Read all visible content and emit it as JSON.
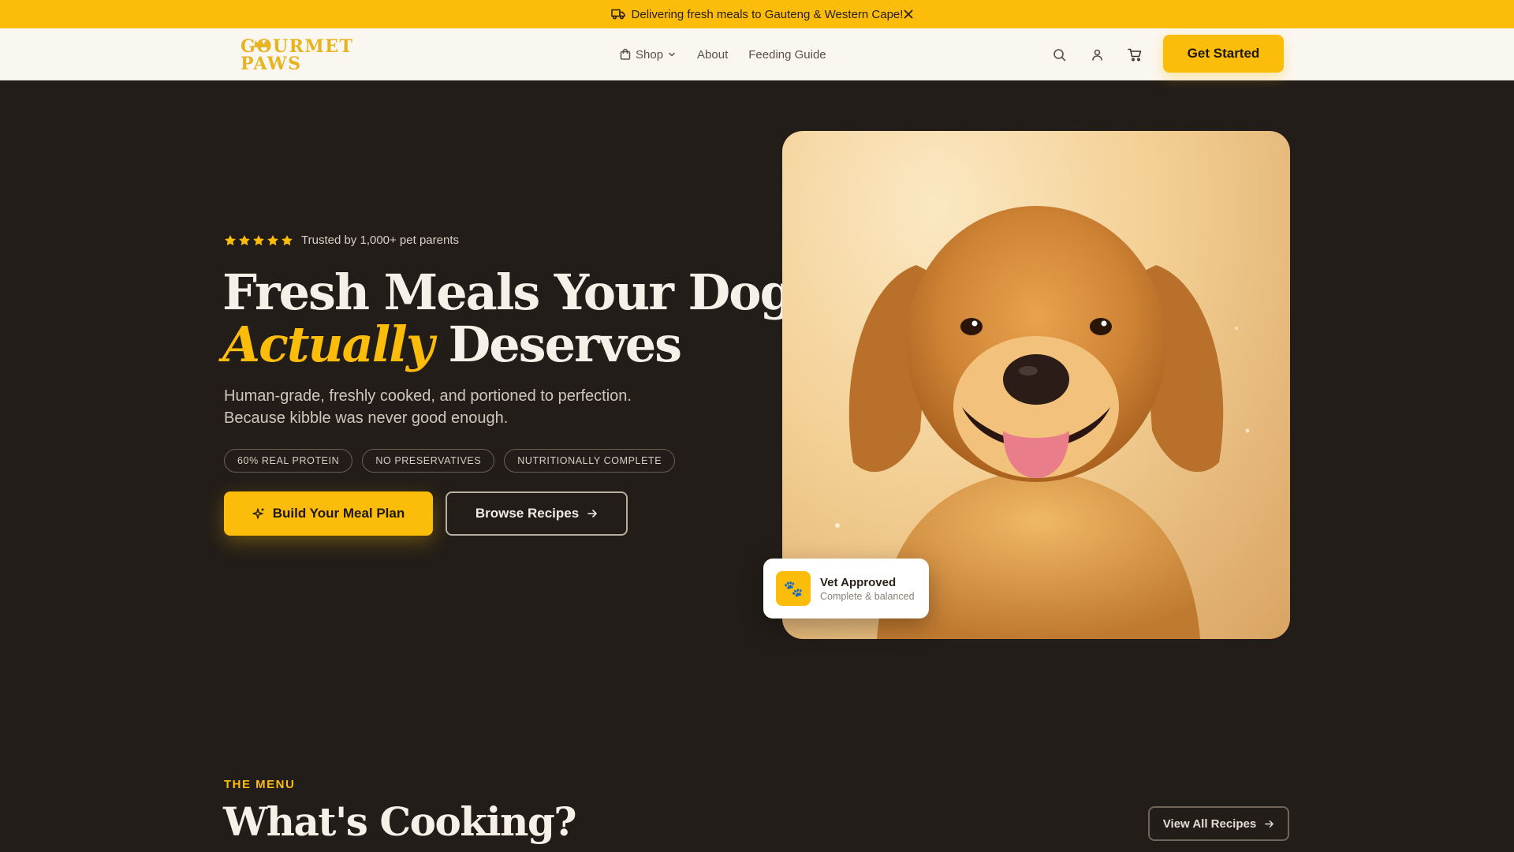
{
  "announcement": {
    "text": "Delivering fresh meals to Gauteng & Western Cape!",
    "icon": "truck-icon",
    "close_icon": "close-icon"
  },
  "header": {
    "logo_text": "GOURMET PAWS",
    "nav": [
      {
        "label": "Shop",
        "icon": "shopping-bag-icon",
        "has_dropdown": true
      },
      {
        "label": "About"
      },
      {
        "label": "Feeding Guide"
      }
    ],
    "icons": [
      "search-icon",
      "user-icon",
      "cart-icon"
    ],
    "cta_label": "Get Started"
  },
  "hero": {
    "rating_stars": 5,
    "rating_text": "Trusted by 1,000+ pet parents",
    "title_line1": "Fresh Meals Your Dog",
    "title_accent": "Actually",
    "title_line2_rest": " Deserves",
    "subtitle": "Human-grade, freshly cooked, and portioned to perfection. Because kibble was never good enough.",
    "pills": [
      "60% REAL PROTEIN",
      "NO PRESERVATIVES",
      "NUTRITIONALLY COMPLETE"
    ],
    "primary_button": "Build Your Meal Plan",
    "secondary_button": "Browse Recipes"
  },
  "vet_card": {
    "title": "Vet Approved",
    "subtitle": "Complete & balanced",
    "icon": "paw-icon"
  },
  "menu_section": {
    "eyebrow": "THE MENU",
    "title": "What's Cooking?",
    "view_all_button": "View All Recipes"
  },
  "colors": {
    "accent": "#fcbd0a",
    "background": "#221d18",
    "header_bg": "#faf7f1"
  }
}
